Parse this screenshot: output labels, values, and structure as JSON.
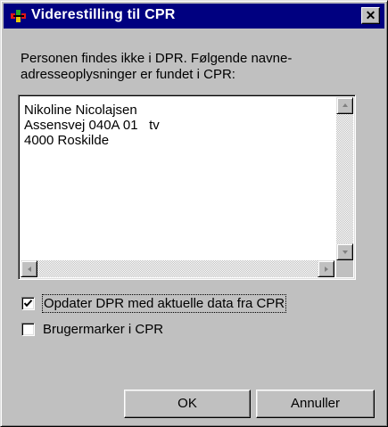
{
  "window": {
    "title": "Viderestilling til CPR",
    "close_label": "✕"
  },
  "message": {
    "line1": "Personen findes ikke i DPR. Følgende navne-",
    "line2": "adresseoplysninger er fundet i CPR:"
  },
  "address": {
    "lines": [
      "Nikoline Nicolajsen",
      "Assensvej 040A 01   tv",
      "4000 Roskilde"
    ]
  },
  "options": [
    {
      "label": "Opdater DPR med aktuelle data fra CPR",
      "checked": true
    },
    {
      "label": "Brugermarker i CPR",
      "checked": false
    }
  ],
  "buttons": {
    "ok": "OK",
    "cancel": "Annuller"
  },
  "colors": {
    "title_bar": "#000080",
    "face": "#c0c0c0"
  }
}
